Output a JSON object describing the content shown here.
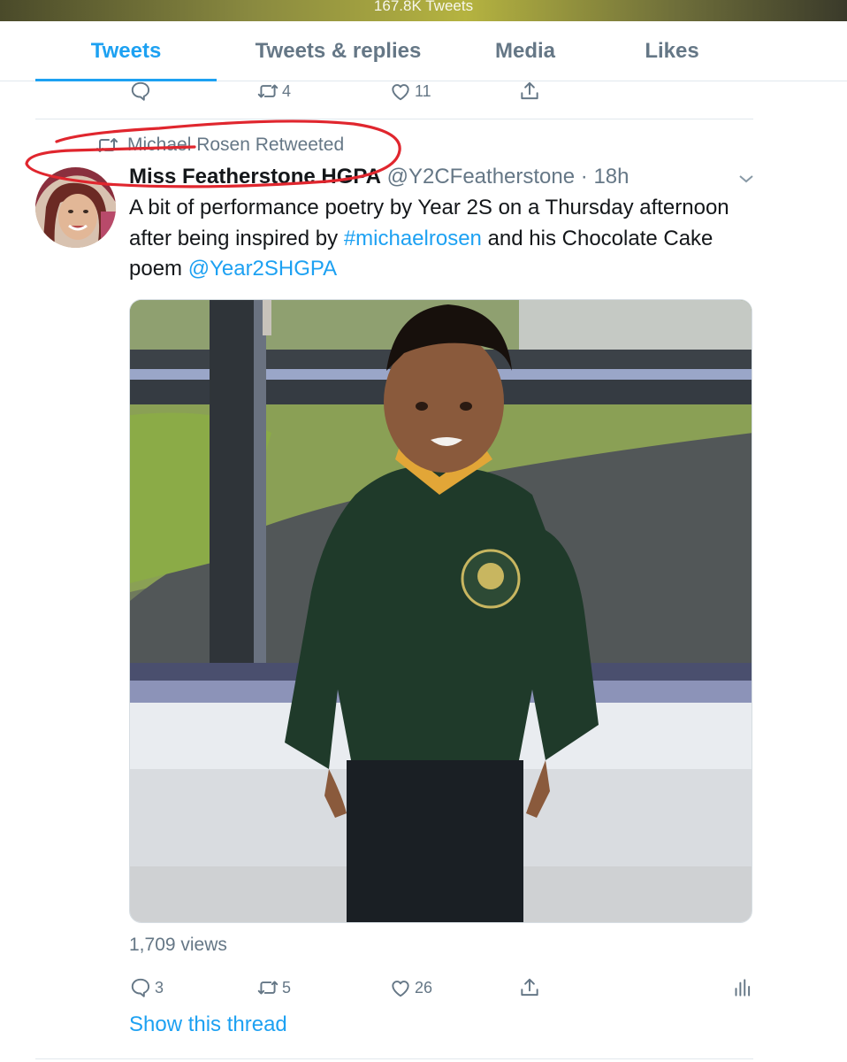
{
  "status_bar": {
    "tweet_count": "167.8K Tweets"
  },
  "tabs": [
    {
      "label": "Tweets",
      "active": true
    },
    {
      "label": "Tweets & replies",
      "active": false
    },
    {
      "label": "Media",
      "active": false
    },
    {
      "label": "Likes",
      "active": false
    }
  ],
  "previous_tweet_actions": {
    "reply_count": "",
    "retweet_count": "4",
    "like_count": "11"
  },
  "tweet": {
    "retweeted_by": "Michael Rosen Retweeted",
    "author_name": "Miss Featherstone HGPA",
    "author_handle": "@Y2CFeatherstone",
    "separator": " · ",
    "time": "18h",
    "text_part1": "A bit of performance poetry by Year 2S on a Thursday afternoon after being inspired by ",
    "hashtag": "#michaelrosen",
    "text_part2": " and his Chocolate Cake poem ",
    "mention": "@Year2SHGPA",
    "views": "1,709 views",
    "reply_count": "3",
    "retweet_count": "5",
    "like_count": "26",
    "show_thread": "Show this thread"
  },
  "colors": {
    "accent": "#1da1f2",
    "secondary_text": "#657786",
    "annotation": "#e0262e"
  },
  "icons": [
    "reply-icon",
    "retweet-icon",
    "like-icon",
    "share-icon",
    "analytics-icon",
    "chevron-down-icon"
  ]
}
